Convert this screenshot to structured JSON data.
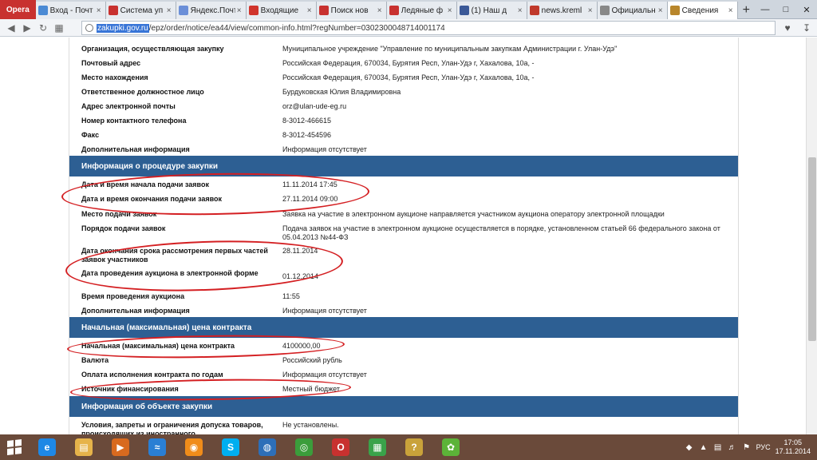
{
  "browser": {
    "menu_label": "Opera",
    "tabs": [
      {
        "label": "Вход - Почт",
        "color": "#4a8ad4"
      },
      {
        "label": "Система уп",
        "color": "#c8312f"
      },
      {
        "label": "Яндекс.Почт",
        "color": "#6b8fd8"
      },
      {
        "label": "Входящие",
        "color": "#d0342c"
      },
      {
        "label": "Поиск нов",
        "color": "#c8312f"
      },
      {
        "label": "Ледяные ф",
        "color": "#c8312f"
      },
      {
        "label": "(1) Наш д",
        "color": "#3b5998"
      },
      {
        "label": "news.kreml",
        "color": "#c0392b"
      },
      {
        "label": "Официальн",
        "color": "#888888"
      },
      {
        "label": "Сведения",
        "color": "#b8862b"
      }
    ],
    "new_tab": "+",
    "url_host": "zakupki.gov.ru",
    "url_path": "/epz/order/notice/ea44/view/common-info.html?regNumber=0302300048714001174"
  },
  "rows_top": [
    {
      "label": "Организация, осуществляющая закупку",
      "value": "Муниципальное учреждение \"Управление по муниципальным закупкам Администрации г. Улан-Удэ\""
    },
    {
      "label": "Почтовый адрес",
      "value": "Российская Федерация, 670034, Бурятия Респ, Улан-Удэ г, Хахалова, 10а, -"
    },
    {
      "label": "Место нахождения",
      "value": "Российская Федерация, 670034, Бурятия Респ, Улан-Удэ г, Хахалова, 10а, -"
    },
    {
      "label": "Ответственное должностное лицо",
      "value": "Бурдуковская Юлия Владимировна"
    },
    {
      "label": "Адрес электронной почты",
      "value": "orz@ulan-ude-eg.ru"
    },
    {
      "label": "Номер контактного телефона",
      "value": "8-3012-466615"
    },
    {
      "label": "Факс",
      "value": "8-3012-454596"
    },
    {
      "label": "Дополнительная информация",
      "value": "Информация отсутствует"
    }
  ],
  "section_procedure": "Информация о процедуре закупки",
  "rows_procedure": [
    {
      "label": "Дата и время начала подачи заявок",
      "value": "11.11.2014 17:45"
    },
    {
      "label": "Дата и время окончания подачи заявок",
      "value": "27.11.2014 09:00"
    },
    {
      "label": "Место подачи заявок",
      "value": "Заявка на участие в электронном аукционе направляется участником аукциона оператору электронной площадки"
    },
    {
      "label": "Порядок подачи заявок",
      "value": "Подача заявок на участие в электронном аукционе осуществляется в порядке, установленном статьей 66 федерального закона от 05.04.2013 №44-ФЗ"
    },
    {
      "label": "Дата окончания срока рассмотрения первых частей заявок участников",
      "value": "28.11.2014"
    },
    {
      "label": "Дата проведения аукциона в электронной форме",
      "value": "01.12.2014"
    },
    {
      "label": "Время проведения аукциона",
      "value": "11:55"
    },
    {
      "label": "Дополнительная информация",
      "value": "Информация отсутствует"
    }
  ],
  "section_price": "Начальная (максимальная) цена контракта",
  "rows_price": [
    {
      "label": "Начальная (максимальная) цена контракта",
      "value": "4100000,00"
    },
    {
      "label": "Валюта",
      "value": "Российский рубль"
    },
    {
      "label": "Оплата исполнения контракта по годам",
      "value": "Информация отсутствует"
    },
    {
      "label": "Источник финансирования",
      "value": "Местный бюджет"
    }
  ],
  "section_object": "Информация об объекте закупки",
  "rows_object": [
    {
      "label": "Условия, запреты и ограничения допуска товаров, происходящих из иностранного",
      "value": "Не установлены."
    }
  ],
  "taskbar": {
    "apps": [
      {
        "icon": "ie-icon",
        "glyph": "e",
        "color": "#1e88e5"
      },
      {
        "icon": "explorer-icon",
        "glyph": "▤",
        "color": "#e6b34a"
      },
      {
        "icon": "media-icon",
        "glyph": "▶",
        "color": "#d86a1f"
      },
      {
        "icon": "app-icon",
        "glyph": "≈",
        "color": "#2a7fd4"
      },
      {
        "icon": "rss-icon",
        "glyph": "◉",
        "color": "#f08c1a"
      },
      {
        "icon": "skype-icon",
        "glyph": "S",
        "color": "#00aff0"
      },
      {
        "icon": "globe-icon",
        "glyph": "◍",
        "color": "#2d6fb8"
      },
      {
        "icon": "chrome-icon",
        "glyph": "◎",
        "color": "#3b9d3b"
      },
      {
        "icon": "opera-icon",
        "glyph": "O",
        "color": "#c8312f"
      },
      {
        "icon": "calculator-icon",
        "glyph": "▦",
        "color": "#3aa34a"
      },
      {
        "icon": "help-icon",
        "glyph": "?",
        "color": "#c9a23a"
      },
      {
        "icon": "icq-icon",
        "glyph": "✿",
        "color": "#5cb338"
      }
    ],
    "lang": "РУС",
    "time": "17:05",
    "date": "17.11.2014"
  }
}
